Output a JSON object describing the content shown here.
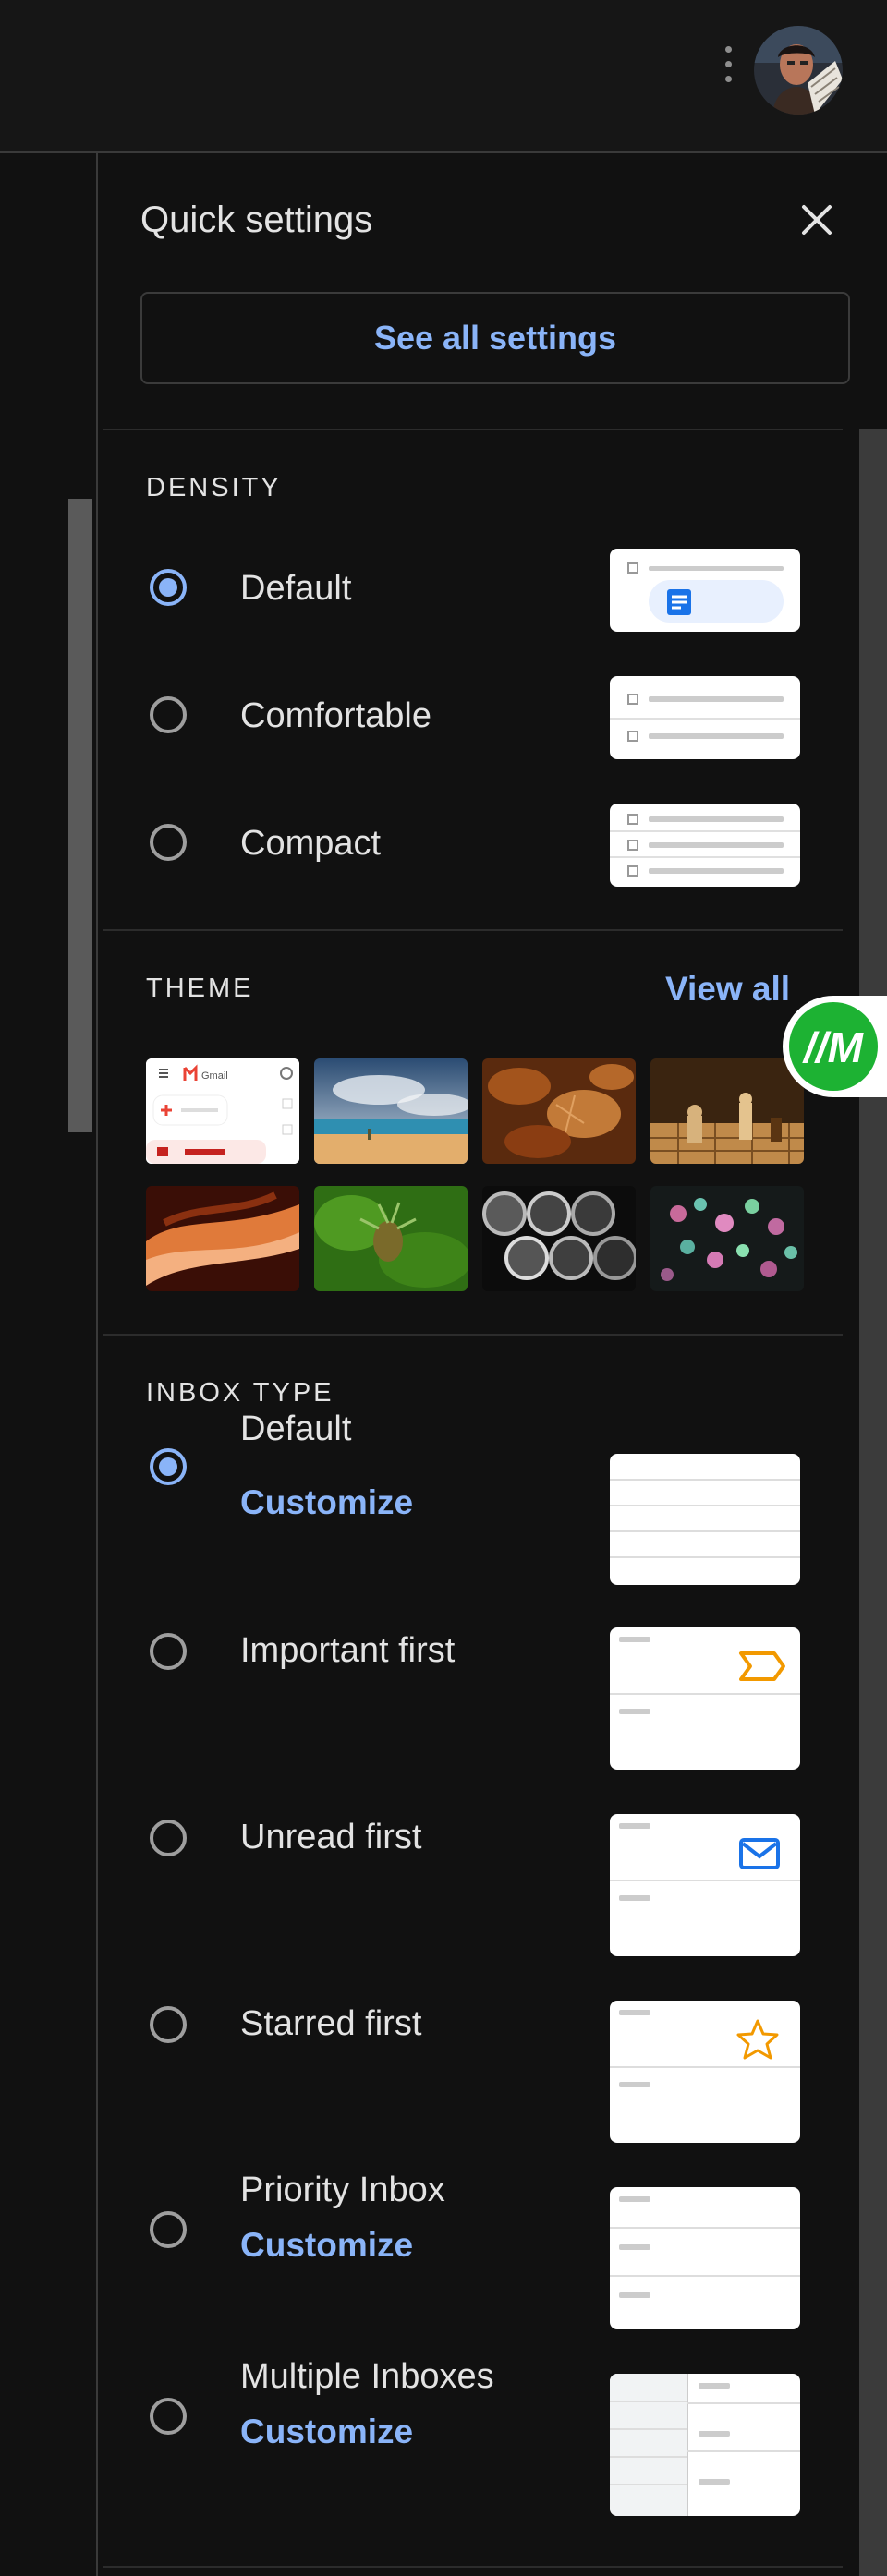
{
  "header": {
    "more_icon": "vertical-dots-icon",
    "avatar": "user-avatar"
  },
  "quick_settings": {
    "title": "Quick settings",
    "close_icon": "close-icon",
    "see_all_label": "See all settings"
  },
  "density": {
    "heading": "DENSITY",
    "options": [
      {
        "label": "Default",
        "selected": true
      },
      {
        "label": "Comfortable",
        "selected": false
      },
      {
        "label": "Compact",
        "selected": false
      }
    ]
  },
  "theme": {
    "heading": "THEME",
    "view_all_label": "View all",
    "gmail_thumb_text": "Gmail",
    "thumbnails": [
      "Default Gmail theme",
      "Beach",
      "Autumn leaves",
      "Chess",
      "Canyon",
      "Green plant",
      "Pipes",
      "Bokeh lights"
    ]
  },
  "inbox_type": {
    "heading": "INBOX TYPE",
    "customize_label": "Customize",
    "options": [
      {
        "label": "Default",
        "selected": true,
        "customize": true
      },
      {
        "label": "Important first",
        "selected": false,
        "icon": "important-marker-icon"
      },
      {
        "label": "Unread first",
        "selected": false,
        "icon": "envelope-icon"
      },
      {
        "label": "Starred first",
        "selected": false,
        "icon": "star-icon"
      },
      {
        "label": "Priority Inbox",
        "selected": false,
        "customize": true
      },
      {
        "label": "Multiple Inboxes",
        "selected": false,
        "customize": true
      }
    ]
  },
  "colors": {
    "accent": "#8ab4f8",
    "background": "#111111",
    "text": "#e3e3e3",
    "important": "#f29900",
    "badge": "#1db233"
  },
  "extension_badge": {
    "text": "//M"
  }
}
